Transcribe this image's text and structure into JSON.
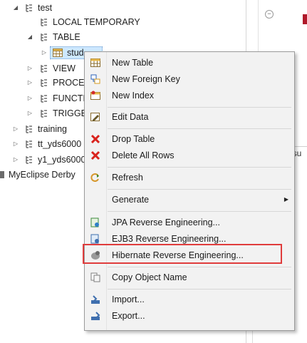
{
  "tree": {
    "rows": [
      {
        "label": "test",
        "twisty": "◢",
        "icon": "schema-icon"
      },
      {
        "label": "LOCAL TEMPORARY",
        "twisty": "",
        "icon": "schema-icon"
      },
      {
        "label": "TABLE",
        "twisty": "◢",
        "icon": "schema-icon"
      },
      {
        "label": "stud",
        "twisty": "▷",
        "icon": "table-icon"
      },
      {
        "label": "VIEW",
        "twisty": "▷",
        "icon": "schema-icon"
      },
      {
        "label": "PROCE",
        "twisty": "▷",
        "icon": "schema-icon"
      },
      {
        "label": "FUNCTI",
        "twisty": "▷",
        "icon": "schema-icon"
      },
      {
        "label": "TRIGGE",
        "twisty": "▷",
        "icon": "schema-icon"
      },
      {
        "label": "training",
        "twisty": "▷",
        "icon": "schema-icon"
      },
      {
        "label": "tt_yds6000",
        "twisty": "▷",
        "icon": "schema-icon"
      },
      {
        "label": "y1_yds6000",
        "twisty": "▷",
        "icon": "schema-icon"
      },
      {
        "label": "MyEclipse Derby",
        "twisty": "",
        "icon": "database-icon"
      }
    ]
  },
  "right_pane": {
    "resu": "esu"
  },
  "context_menu": {
    "items": [
      {
        "label": "New Table",
        "icon": "new-table-icon"
      },
      {
        "label": "New Foreign Key",
        "icon": "foreign-key-icon"
      },
      {
        "label": "New Index",
        "icon": "index-icon"
      },
      {
        "label": "Edit Data",
        "icon": "edit-data-icon"
      },
      {
        "label": "Drop Table",
        "icon": "drop-icon"
      },
      {
        "label": "Delete All Rows",
        "icon": "delete-icon"
      },
      {
        "label": "Refresh",
        "icon": "refresh-icon"
      },
      {
        "label": "Generate",
        "icon": "",
        "submenu": true
      },
      {
        "label": "JPA Reverse Engineering...",
        "icon": "jpa-icon"
      },
      {
        "label": "EJB3 Reverse Engineering...",
        "icon": "ejb3-icon"
      },
      {
        "label": "Hibernate Reverse Engineering...",
        "icon": "hibernate-icon"
      },
      {
        "label": "Copy Object Name",
        "icon": "copy-icon"
      },
      {
        "label": "Import...",
        "icon": "import-icon"
      },
      {
        "label": "Export...",
        "icon": "export-icon"
      }
    ]
  },
  "colors": {
    "highlight_border": "#e03c3c",
    "drop_red": "#d9221c"
  }
}
